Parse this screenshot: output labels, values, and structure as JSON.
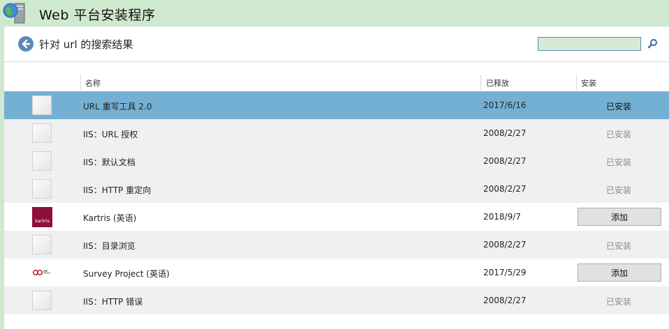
{
  "window": {
    "title": "Web 平台安装程序"
  },
  "header": {
    "title": "针对 url 的搜索结果",
    "search_value": ""
  },
  "columns": {
    "name": "名称",
    "released": "已释放",
    "install": "安装"
  },
  "rows": [
    {
      "icon": "placeholder-icon",
      "name": "URL 重写工具 2.0",
      "date": "2017/6/16",
      "status": "已安装",
      "action": "",
      "selected": true
    },
    {
      "icon": "placeholder-icon",
      "name": "IIS：URL 授权",
      "date": "2008/2/27",
      "status": "已安装",
      "action": ""
    },
    {
      "icon": "placeholder-icon",
      "name": "IIS：默认文档",
      "date": "2008/2/27",
      "status": "已安装",
      "action": ""
    },
    {
      "icon": "placeholder-icon",
      "name": "IIS：HTTP 重定向",
      "date": "2008/2/27",
      "status": "已安装",
      "action": ""
    },
    {
      "icon": "kartris-logo-icon",
      "name": "Kartris (英语)",
      "date": "2018/9/7",
      "status": "",
      "action": "添加",
      "logo_text": "kartris"
    },
    {
      "icon": "placeholder-icon",
      "name": "IIS：目录浏览",
      "date": "2008/2/27",
      "status": "已安装",
      "action": ""
    },
    {
      "icon": "survey-project-logo-icon",
      "name": "Survey Project (英语)",
      "date": "2017/5/29",
      "status": "",
      "action": "添加"
    },
    {
      "icon": "placeholder-icon",
      "name": "IIS：HTTP 错误",
      "date": "2008/2/27",
      "status": "已安装",
      "action": ""
    }
  ],
  "colors": {
    "title_bar": "#cfe8d0",
    "selected_row": "#74b0d3",
    "alt_row": "#eff0f1",
    "back_button": "#5b8ab6",
    "kartris_brand": "#8e0f3c",
    "survey_brand": "#c0282d"
  }
}
